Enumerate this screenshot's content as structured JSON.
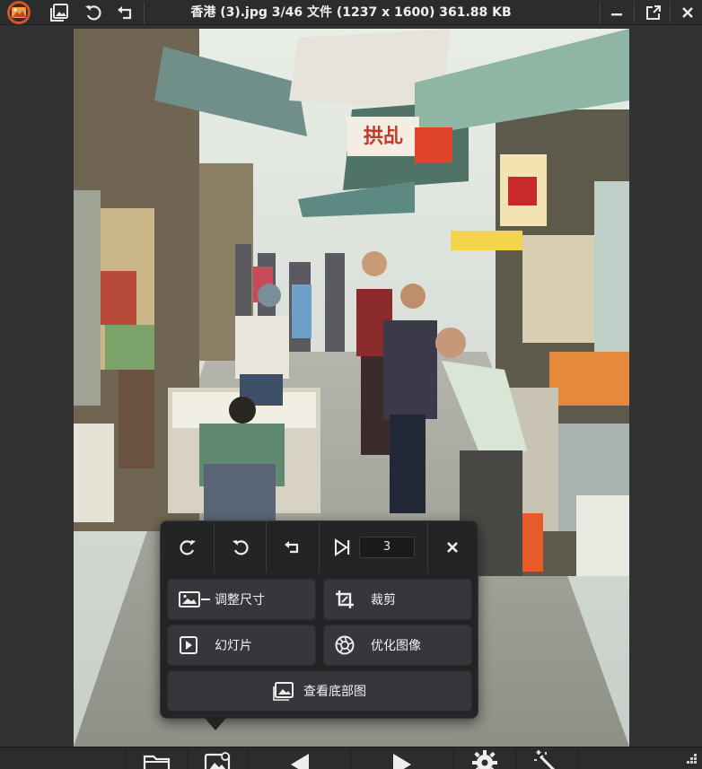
{
  "titlebar": {
    "title": "香港 (3).jpg 3/46 文件 (1237 x 1600) 361.88 KB",
    "icons": [
      "app-logo-icon",
      "gallery-icon",
      "rotate-left-icon",
      "undo-icon",
      "minimize-icon",
      "maximize-icon",
      "close-icon"
    ]
  },
  "panel": {
    "page_value": "3",
    "buttons": {
      "resize": "调整尺寸",
      "crop": "裁剪",
      "slideshow": "幻灯片",
      "optimize": "优化图像",
      "view_bottom": "查看底部图"
    }
  },
  "bottombar": {
    "icons": [
      "folder-icon",
      "image-settings-icon",
      "prev-icon",
      "next-icon",
      "settings-icon",
      "magic-wand-icon",
      "resize-grip-icon"
    ]
  },
  "colors": {
    "chrome": "#2b2c2e",
    "panel": "#232426",
    "button": "#35373a",
    "accent_logo": "#e0502a"
  }
}
